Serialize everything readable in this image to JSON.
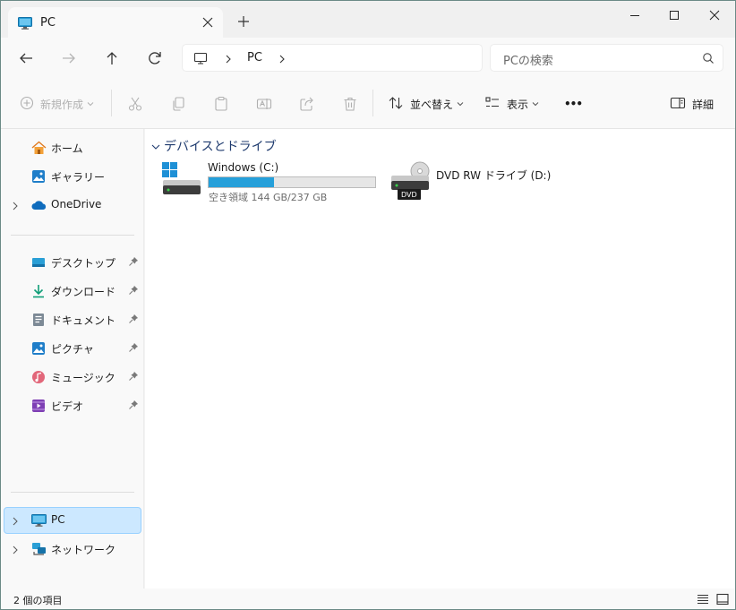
{
  "tab": {
    "title": "PC"
  },
  "address": {
    "segment": "PC"
  },
  "search": {
    "placeholder": "PCの検索"
  },
  "toolbar": {
    "new_label": "新規作成",
    "sort_label": "並べ替え",
    "view_label": "表示",
    "more_label": "•••",
    "details_label": "詳細"
  },
  "sidebar": {
    "top": [
      {
        "label": "ホーム"
      },
      {
        "label": "ギャラリー"
      },
      {
        "label": "OneDrive"
      }
    ],
    "pinned": [
      {
        "label": "デスクトップ"
      },
      {
        "label": "ダウンロード"
      },
      {
        "label": "ドキュメント"
      },
      {
        "label": "ピクチャ"
      },
      {
        "label": "ミュージック"
      },
      {
        "label": "ビデオ"
      }
    ],
    "bottom": [
      {
        "label": "PC"
      },
      {
        "label": "ネットワーク"
      }
    ]
  },
  "content": {
    "group_title": "デバイスとドライブ",
    "drives": [
      {
        "name": "Windows  (C:)",
        "free_text": "空き領域 144 GB/237 GB",
        "used_fraction": 0.3924
      },
      {
        "name": "DVD RW ドライブ (D:)",
        "badge": "DVD"
      }
    ]
  },
  "status": {
    "item_count": "2 個の項目"
  },
  "colors": {
    "accent": "#26a0da",
    "selection": "#cce8ff",
    "group_title": "#1e3a6e"
  }
}
